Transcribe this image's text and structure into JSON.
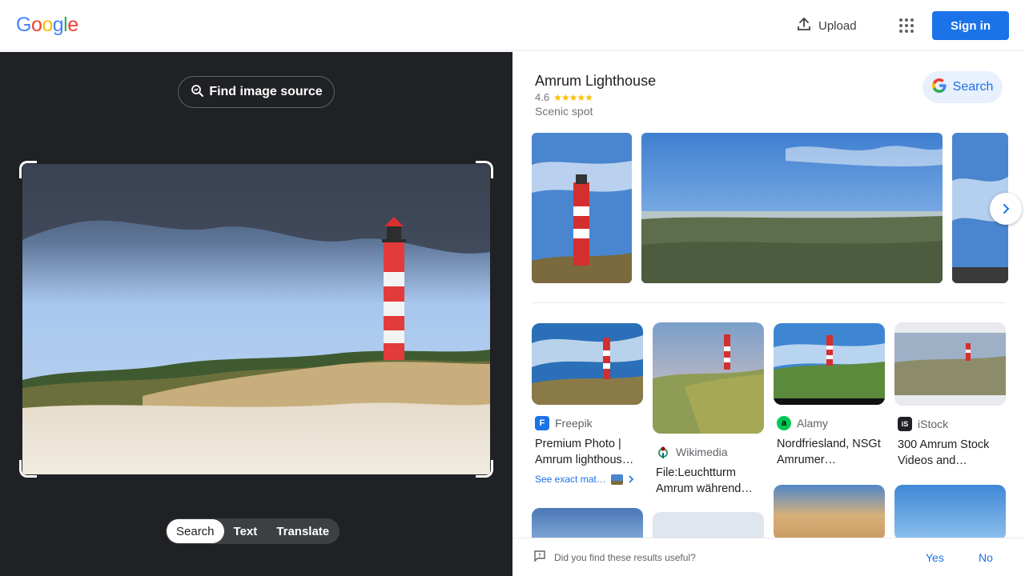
{
  "header": {
    "logo_letters": [
      {
        "char": "G",
        "color": "#4285f4"
      },
      {
        "char": "o",
        "color": "#ea4335"
      },
      {
        "char": "o",
        "color": "#fbbc05"
      },
      {
        "char": "g",
        "color": "#4285f4"
      },
      {
        "char": "l",
        "color": "#34a853"
      },
      {
        "char": "e",
        "color": "#ea4335"
      }
    ],
    "upload_label": "Upload",
    "apps_icon": "apps-grid-icon",
    "signin_label": "Sign in"
  },
  "left_pane": {
    "find_source_label": "Find image source",
    "modes": [
      "Search",
      "Text",
      "Translate"
    ],
    "active_mode": "Search"
  },
  "knowledge_panel": {
    "title": "Amrum Lighthouse",
    "rating": "4.6",
    "stars": 4.6,
    "type": "Scenic spot",
    "search_label": "Search"
  },
  "results": [
    {
      "source": "Freepik",
      "favicon_color": "#1a73e8",
      "favicon_letter": "F",
      "title": "Premium Photo | Amrum lighthous…",
      "exact_label": "See exact mat…"
    },
    {
      "source": "Wikimedia",
      "favicon_color": "#ffffff",
      "favicon_letter": "",
      "title": "File:Leuchtturm Amrum während…"
    },
    {
      "source": "Alamy",
      "favicon_color": "#00c853",
      "favicon_letter": "a",
      "title": "Nordfriesland, NSGt Amrumer…"
    },
    {
      "source": "iStock",
      "favicon_color": "#202124",
      "favicon_letter": "iS",
      "title": "300 Amrum Stock Videos and…"
    }
  ],
  "footer": {
    "question": "Did you find these results useful?",
    "yes_label": "Yes",
    "no_label": "No"
  }
}
